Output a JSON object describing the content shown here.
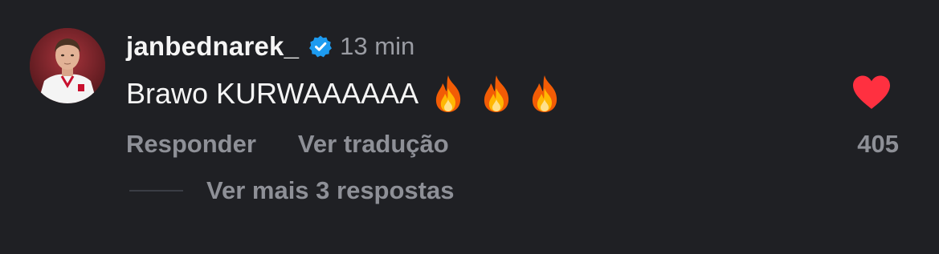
{
  "comment": {
    "username": "janbednarek_",
    "verified_icon": "verified-badge-icon",
    "time": "13 min",
    "text": "Brawo KURWAAAAAA",
    "emojis": [
      "fire-icon",
      "fire-icon",
      "fire-icon"
    ],
    "actions": {
      "reply_label": "Responder",
      "translate_label": "Ver tradução"
    },
    "like": {
      "icon": "heart-icon",
      "count": "405",
      "liked": true,
      "color": "#ff3040"
    },
    "replies": {
      "label": "Ver mais 3 respostas"
    }
  },
  "colors": {
    "background": "#1f2024",
    "primary_text": "#f5f5f5",
    "secondary_text": "#8e9097",
    "verified_blue": "#1d9bf0"
  }
}
